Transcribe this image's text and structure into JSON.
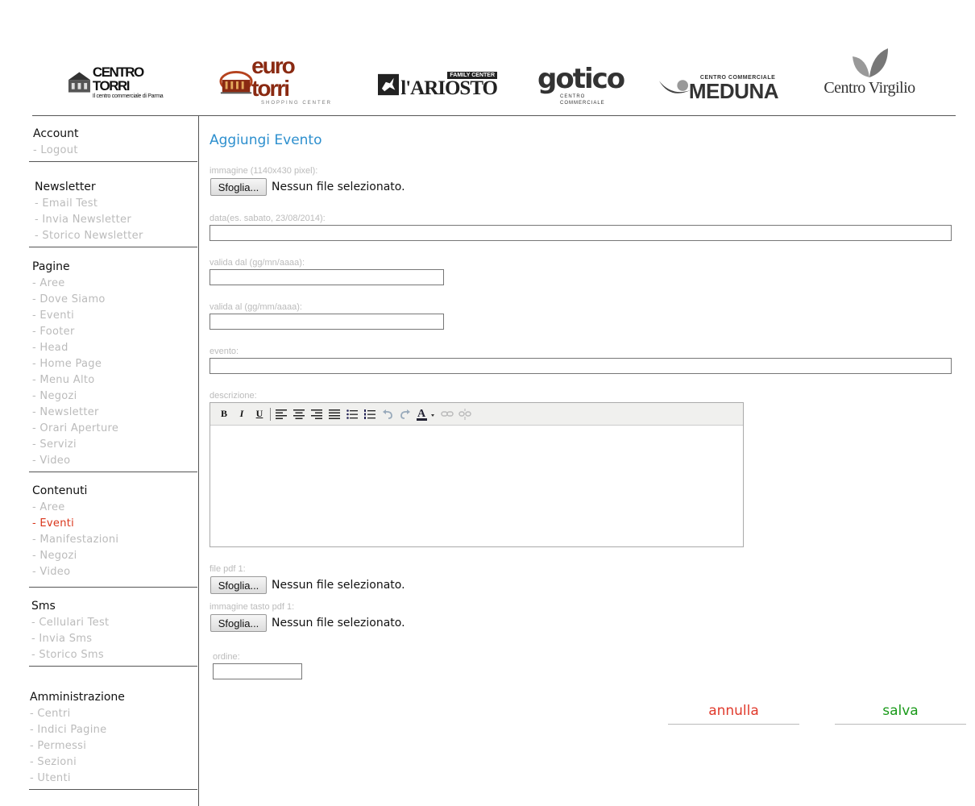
{
  "logos": [
    {
      "name": "CENTRO TORRI",
      "tagline": "Il centro commerciale di Parma"
    },
    {
      "name": "euro torri",
      "tagline": "SHOPPING CENTER"
    },
    {
      "name": "l'ARIOSTO",
      "tagline": "FAMILY CENTER"
    },
    {
      "name": "gotico",
      "tagline": "CENTRO COMMERCIALE"
    },
    {
      "name": "MEDUNA",
      "tagline": "CENTRO COMMERCIALE"
    },
    {
      "name": "Centro Virgilio",
      "tagline": ""
    }
  ],
  "sidebar": {
    "account": {
      "title": "Account",
      "items": [
        "- Logout"
      ]
    },
    "newsletter": {
      "title": "Newsletter",
      "items": [
        "- Email Test",
        "- Invia Newsletter",
        "- Storico Newsletter"
      ]
    },
    "pagine": {
      "title": "Pagine",
      "items": [
        "- Aree",
        "- Dove Siamo",
        "- Eventi",
        "- Footer",
        "- Head",
        "- Home Page",
        "- Menu Alto",
        "- Negozi",
        "- Newsletter",
        "- Orari Aperture",
        "- Servizi",
        "- Video"
      ]
    },
    "contenuti": {
      "title": "Contenuti",
      "items": [
        "- Aree",
        "- Eventi",
        "- Manifestazioni",
        "- Negozi",
        "- Video"
      ],
      "active_index": 1
    },
    "sms": {
      "title": "Sms",
      "items": [
        "- Cellulari Test",
        "- Invia Sms",
        "- Storico Sms"
      ]
    },
    "amministrazione": {
      "title": "Amministrazione",
      "items": [
        "- Centri",
        "- Indici Pagine",
        "- Permessi",
        "- Sezioni",
        "- Utenti"
      ]
    }
  },
  "form": {
    "title": "Aggiungi Evento",
    "image_label": "immagine (1140x430 pixel):",
    "browse_label": "Sfoglia...",
    "no_file": "Nessun file selezionato.",
    "date_label": "data(es. sabato, 23/08/2014):",
    "date_value": "",
    "valid_from_label": "valida dal (gg/mn/aaaa):",
    "valid_from_value": "",
    "valid_to_label": "valida al (gg/mm/aaaa):",
    "valid_to_value": "",
    "event_label": "evento:",
    "event_value": "",
    "description_label": "descrizione:",
    "pdf_label": "file pdf 1:",
    "pdf_button_image_label": "immagine tasto pdf 1:",
    "order_label": "ordine:",
    "order_value": "",
    "cancel_label": "annulla",
    "save_label": "salva"
  },
  "colors": {
    "accent": "#2d8fce",
    "active": "#d9361b",
    "cancel": "#e03a2c",
    "save": "#1a9a1a"
  }
}
